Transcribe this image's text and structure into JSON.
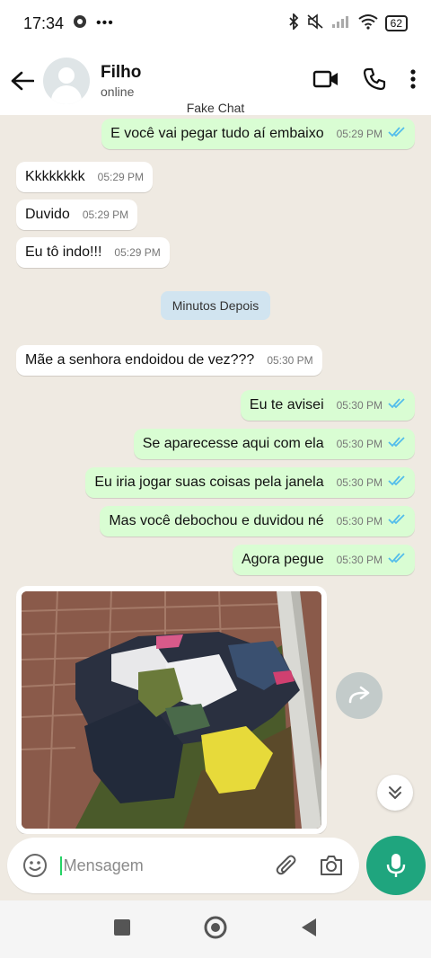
{
  "status_bar": {
    "time": "17:34",
    "battery": "62"
  },
  "header": {
    "contact_name": "Filho",
    "contact_status": "online"
  },
  "fake_label": "Fake Chat",
  "messages": [
    {
      "text": "E você vai pegar tudo aí embaixo",
      "time": "05:29 PM",
      "dir": "out"
    },
    {
      "text": "Kkkkkkkk",
      "time": "05:29 PM",
      "dir": "in"
    },
    {
      "text": "Duvido",
      "time": "05:29 PM",
      "dir": "in"
    },
    {
      "text": "Eu tô indo!!!",
      "time": "05:29 PM",
      "dir": "in"
    },
    {
      "text": "Mãe a senhora endoidou de vez???",
      "time": "05:30 PM",
      "dir": "in"
    },
    {
      "text": "Eu te avisei",
      "time": "05:30 PM",
      "dir": "out"
    },
    {
      "text": "Se aparecesse aqui com ela",
      "time": "05:30 PM",
      "dir": "out"
    },
    {
      "text": "Eu iria jogar suas coisas pela janela",
      "time": "05:30 PM",
      "dir": "out"
    },
    {
      "text": "Mas você debochou e duvidou né",
      "time": "05:30 PM",
      "dir": "out"
    },
    {
      "text": "Agora pegue",
      "time": "05:30 PM",
      "dir": "out"
    }
  ],
  "date_chip": "Minutos Depois",
  "input": {
    "placeholder": "Mensagem"
  },
  "colors": {
    "outgoing_bubble": "#d9fdd3",
    "incoming_bubble": "#ffffff",
    "chat_bg": "#efeae2",
    "accent": "#1fa57e",
    "read_ticks": "#53bdeb"
  }
}
